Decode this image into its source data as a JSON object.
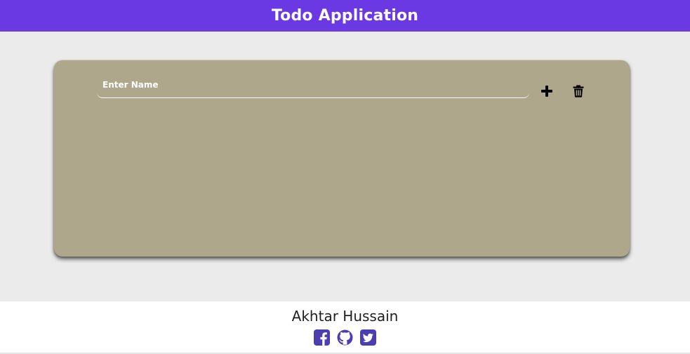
{
  "header": {
    "title": "Todo Application"
  },
  "todo": {
    "input": {
      "placeholder": "Enter Name",
      "value": ""
    },
    "add_icon": "plus-icon",
    "delete_icon": "trash-icon",
    "items": []
  },
  "footer": {
    "author": "Akhtar Hussain",
    "social": [
      {
        "icon": "facebook-icon"
      },
      {
        "icon": "github-icon"
      },
      {
        "icon": "twitter-icon"
      }
    ]
  },
  "colors": {
    "header_bg": "#6b39e3",
    "card_bg": "#aea78b",
    "page_bg": "#ebebeb",
    "social_icon": "#4b3fb0"
  }
}
